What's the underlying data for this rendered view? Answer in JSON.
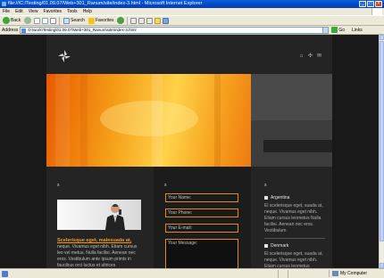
{
  "window": {
    "title": "file:///C:/Testing/01.09.07/Web+301_Ranum/site/index-3.html - Microsoft Internet Explorer",
    "min": "_",
    "max": "□",
    "close": "×"
  },
  "menu": [
    "File",
    "Edit",
    "View",
    "Favorites",
    "Tools",
    "Help"
  ],
  "toolbar": {
    "back": "Back",
    "search": "Search",
    "favorites": "Favorites",
    "back_icon": "back-arrow-icon",
    "forward_icon": "forward-arrow-icon"
  },
  "address": {
    "label": "Address",
    "value": "D:\\work\\Testing\\01.09.07\\Web+301_Ranum\\site\\index-3.html",
    "go": "Go",
    "links": "Links"
  },
  "site": {
    "nav_icons": [
      "home-icon",
      "sitemap-icon",
      "mail-icon"
    ],
    "column_heads": [
      "s",
      "s",
      "s"
    ],
    "news": {
      "title": "Scelerisque eget, malesuada at,",
      "text": "neque. Vivamus eget nibh. Etiam cursus leo vel metus. Nulla facilisi. Aenean nec eros. Vestibulum ante ipsum primis in faucibus orci luctus et ultrices"
    },
    "form": {
      "name": "Your Name:",
      "phone": "Your Phone:",
      "email": "Your E-mail:",
      "message": "Your Message:"
    },
    "countries": [
      {
        "name": "Argentina",
        "text": "El scelerisque eget, suada at, neque. Vivamus eget nibh. Etiam cursus leometus Nulla facilisi. Aenean nec eros. Vestibulum"
      },
      {
        "name": "Denmark",
        "text": "El scelerisque eget, suada at, neque. Vivamus eget nibh. Etiam cursus leometus"
      }
    ]
  },
  "status": {
    "zone": "My Computer"
  },
  "colors": {
    "accent": "#f29a1a",
    "page_bg": "#191919"
  }
}
